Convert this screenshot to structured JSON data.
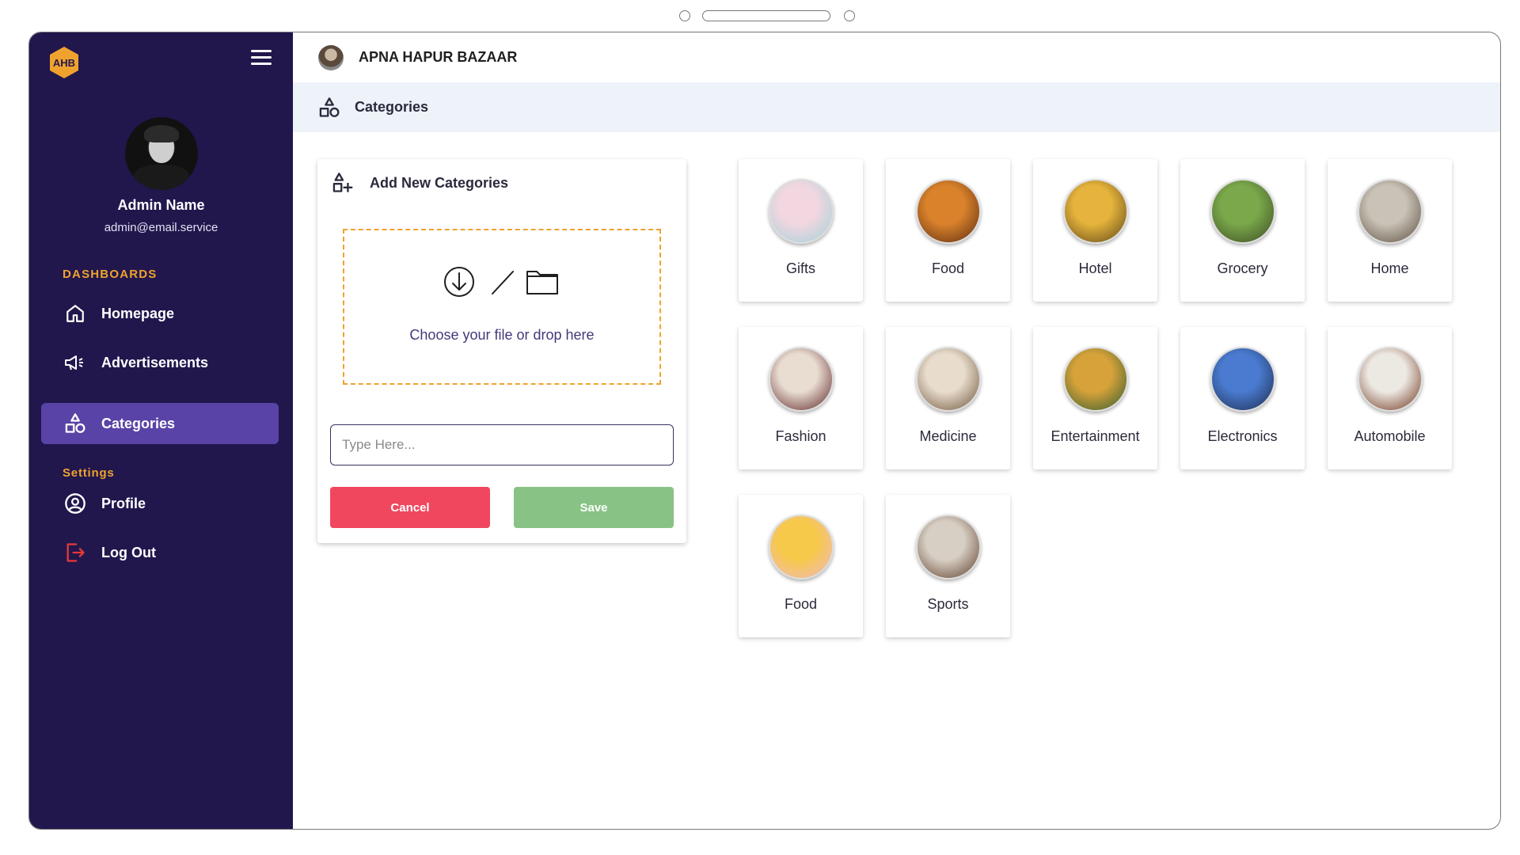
{
  "app": {
    "logo_text": "AHB",
    "store_name": "APNA HAPUR BAZAAR",
    "accent": "#f0a22e",
    "sidebar_bg": "#21174d",
    "active_bg": "#5a43a6"
  },
  "sidebar": {
    "admin_name": "Admin Name",
    "admin_email": "admin@email.service",
    "dashboards_label": "DASHBOARDS",
    "settings_label": "Settings",
    "items": [
      {
        "label": "Homepage",
        "icon": "home-icon"
      },
      {
        "label": "Advertisements",
        "icon": "megaphone-icon"
      },
      {
        "label": "Categories",
        "icon": "shapes-icon",
        "active": true
      }
    ],
    "settings_items": [
      {
        "label": "Profile",
        "icon": "user-circle-icon"
      },
      {
        "label": "Log Out",
        "icon": "logout-icon"
      }
    ]
  },
  "page": {
    "breadcrumb": "Categories"
  },
  "form": {
    "title": "Add New Categories",
    "drop_text": "Choose your file or drop here",
    "input_placeholder": "Type Here...",
    "cancel_label": "Cancel",
    "save_label": "Save",
    "cancel_color": "#f0475e",
    "save_color": "#88c385"
  },
  "categories": [
    {
      "name": "Gifts",
      "colors": [
        "#f2d6e0",
        "#9fd3d8"
      ]
    },
    {
      "name": "Food",
      "colors": [
        "#d9822b",
        "#5a2a12"
      ]
    },
    {
      "name": "Hotel",
      "colors": [
        "#e6b43c",
        "#5b4418"
      ]
    },
    {
      "name": "Grocery",
      "colors": [
        "#7aa84a",
        "#3a4a24"
      ]
    },
    {
      "name": "Home",
      "colors": [
        "#c9c2b6",
        "#5a4e3e"
      ]
    },
    {
      "name": "Fashion",
      "colors": [
        "#e9ddd2",
        "#5a1e22"
      ]
    },
    {
      "name": "Medicine",
      "colors": [
        "#e8dccc",
        "#6a5036"
      ]
    },
    {
      "name": "Entertainment",
      "colors": [
        "#d8a23a",
        "#2c5a2e"
      ]
    },
    {
      "name": "Electronics",
      "colors": [
        "#4a7bd0",
        "#1c2a4a"
      ]
    },
    {
      "name": "Automobile",
      "colors": [
        "#ece8e2",
        "#6a2e14"
      ]
    },
    {
      "name": "Food",
      "colors": [
        "#f6c94a",
        "#f0b8c4"
      ]
    },
    {
      "name": "Sports",
      "colors": [
        "#d8cfc4",
        "#5a3a26"
      ]
    }
  ]
}
